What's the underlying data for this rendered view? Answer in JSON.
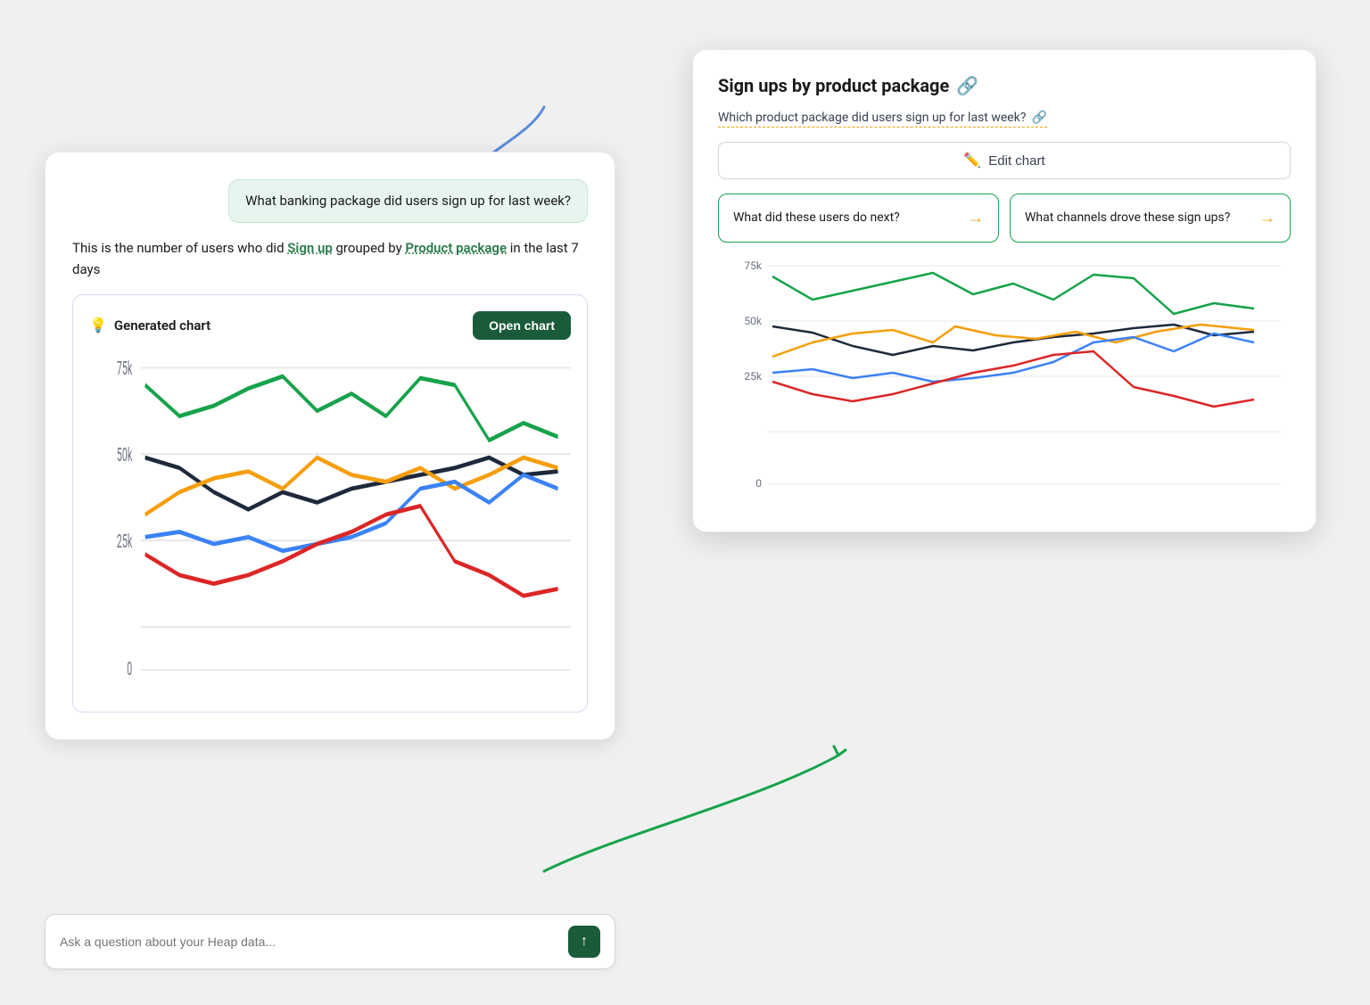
{
  "leftPanel": {
    "userMessage": "What banking package did users sign up for last week?",
    "responseText1": "This is the number of users who did ",
    "responseLink1": "Sign up",
    "responseText2": " grouped by ",
    "responseLink2": "Product package",
    "responseText3": " in the last 7 days",
    "chartCard": {
      "title": "Generated chart",
      "openButton": "Open chart"
    }
  },
  "chatInput": {
    "placeholder": "Ask a question about your Heap data...",
    "sendIcon": "↑"
  },
  "rightPanel": {
    "title": "Sign ups by product package",
    "titleIcon": "🔗",
    "subtitle": "Which product package did users sign up for last week?",
    "subtitleIcon": "🔗",
    "editButton": "Edit chart",
    "suggestions": [
      {
        "text": "What did these users do next?",
        "arrow": "→"
      },
      {
        "text": "What channels drove these sign ups?",
        "arrow": "→"
      }
    ]
  },
  "chartData": {
    "yLabels": [
      "0",
      "25k",
      "50k",
      "75k"
    ],
    "lines": [
      {
        "color": "#16a34a",
        "label": "Green",
        "points": [
          70,
          58,
          62,
          68,
          72,
          60,
          65,
          58,
          72,
          68,
          50,
          55,
          48
        ]
      },
      {
        "color": "#1e293b",
        "label": "Dark",
        "points": [
          48,
          45,
          38,
          34,
          38,
          36,
          40,
          42,
          44,
          46,
          48,
          44,
          45
        ]
      },
      {
        "color": "#f59e0b",
        "label": "Yellow",
        "points": [
          32,
          38,
          42,
          44,
          40,
          48,
          44,
          42,
          46,
          40,
          44,
          48,
          46
        ]
      },
      {
        "color": "#3b82f6",
        "label": "Blue",
        "points": [
          28,
          30,
          26,
          28,
          24,
          26,
          28,
          32,
          40,
          42,
          36,
          44,
          40
        ]
      },
      {
        "color": "#dc2626",
        "label": "Red",
        "points": [
          24,
          18,
          16,
          18,
          22,
          26,
          30,
          34,
          36,
          22,
          18,
          12,
          14
        ]
      }
    ]
  }
}
